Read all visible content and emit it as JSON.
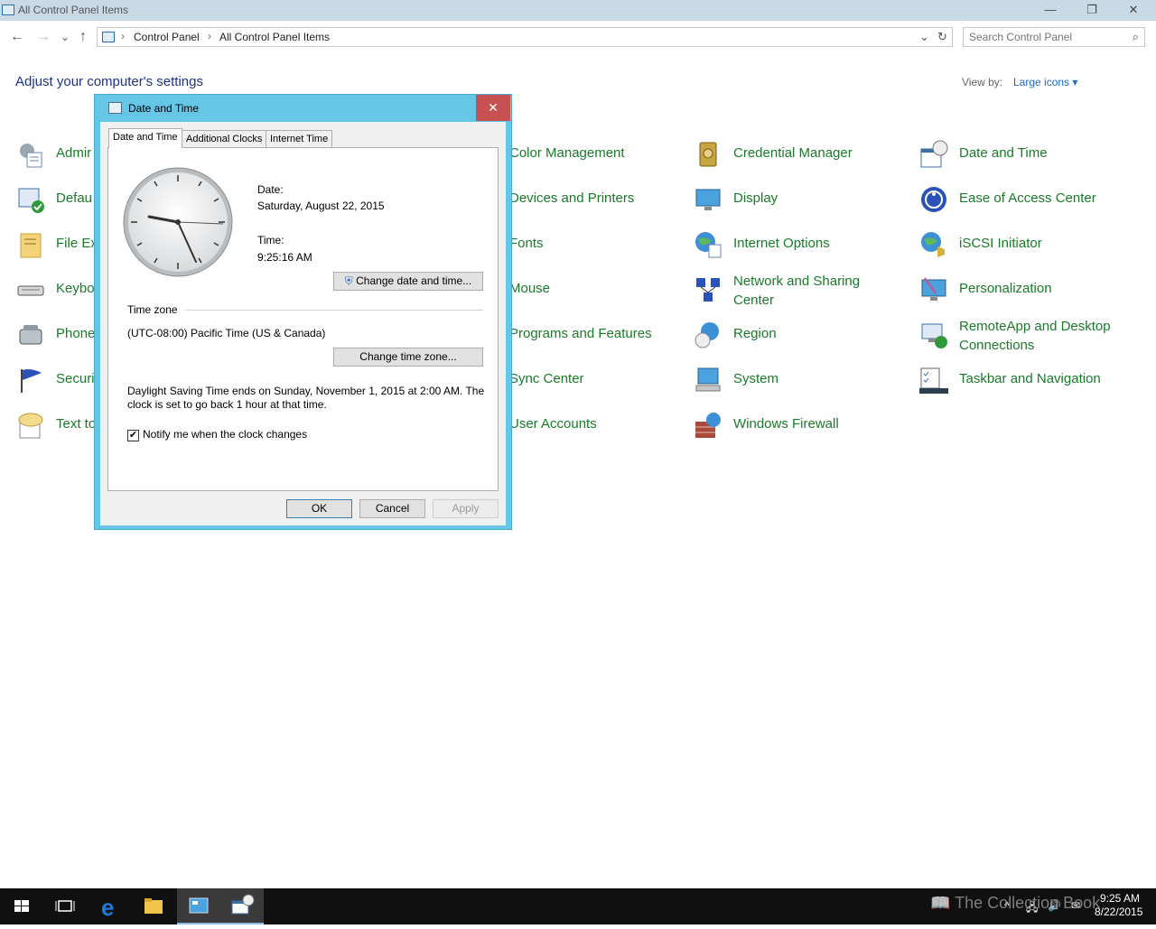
{
  "window": {
    "title": "All Control Panel Items",
    "minimize": "—",
    "restore": "❐",
    "close": "✕"
  },
  "nav": {
    "back": "←",
    "forward": "→",
    "recent": "⌄",
    "up": "↑",
    "breadcrumbs": [
      "Control Panel",
      "All Control Panel Items"
    ],
    "separator": "›",
    "dropdown": "⌄",
    "refresh": "↻"
  },
  "search": {
    "placeholder": "Search Control Panel"
  },
  "main": {
    "heading": "Adjust your computer's settings",
    "view_by_label": "View by:",
    "view_by_value": "Large icons ▾"
  },
  "items": {
    "col1": [
      "Admir",
      "Defau",
      "File Ex",
      "Keybo",
      "Phone",
      "Securi",
      "Text to"
    ],
    "col3": [
      "Color Management",
      "Devices and Printers",
      "Fonts",
      "Mouse",
      "Programs and Features",
      "Sync Center",
      "User Accounts"
    ],
    "col4": [
      "Credential Manager",
      "Display",
      "Internet Options",
      "Network and Sharing",
      "Region",
      "System",
      "Windows Firewall"
    ],
    "col4_extra": "Center",
    "col5": [
      "Date and Time",
      "Ease of Access Center",
      "iSCSI Initiator",
      "Personalization",
      "RemoteApp and Desktop",
      "Taskbar and Navigation"
    ],
    "col5_extra": "Connections"
  },
  "dialog": {
    "title": "Date and Time",
    "close": "✕",
    "tabs": [
      "Date and Time",
      "Additional Clocks",
      "Internet Time"
    ],
    "date_label": "Date:",
    "date_value": "Saturday, August 22, 2015",
    "time_label": "Time:",
    "time_value": "9:25:16 AM",
    "change_datetime": "Change date and time...",
    "timezone_label": "Time zone",
    "timezone_value": "(UTC-08:00) Pacific Time (US & Canada)",
    "change_timezone": "Change time zone...",
    "dst_line1": "Daylight Saving Time ends on Sunday, November 1, 2015 at 2:00 AM. The",
    "dst_line2": "clock is set to go back 1 hour at that time.",
    "notify_checked": "✔",
    "notify_label": "Notify me when the clock changes",
    "ok": "OK",
    "cancel": "Cancel",
    "apply": "Apply"
  },
  "taskbar": {
    "time": "9:25 AM",
    "date": "8/22/2015",
    "watermark": "The Collection Book"
  }
}
